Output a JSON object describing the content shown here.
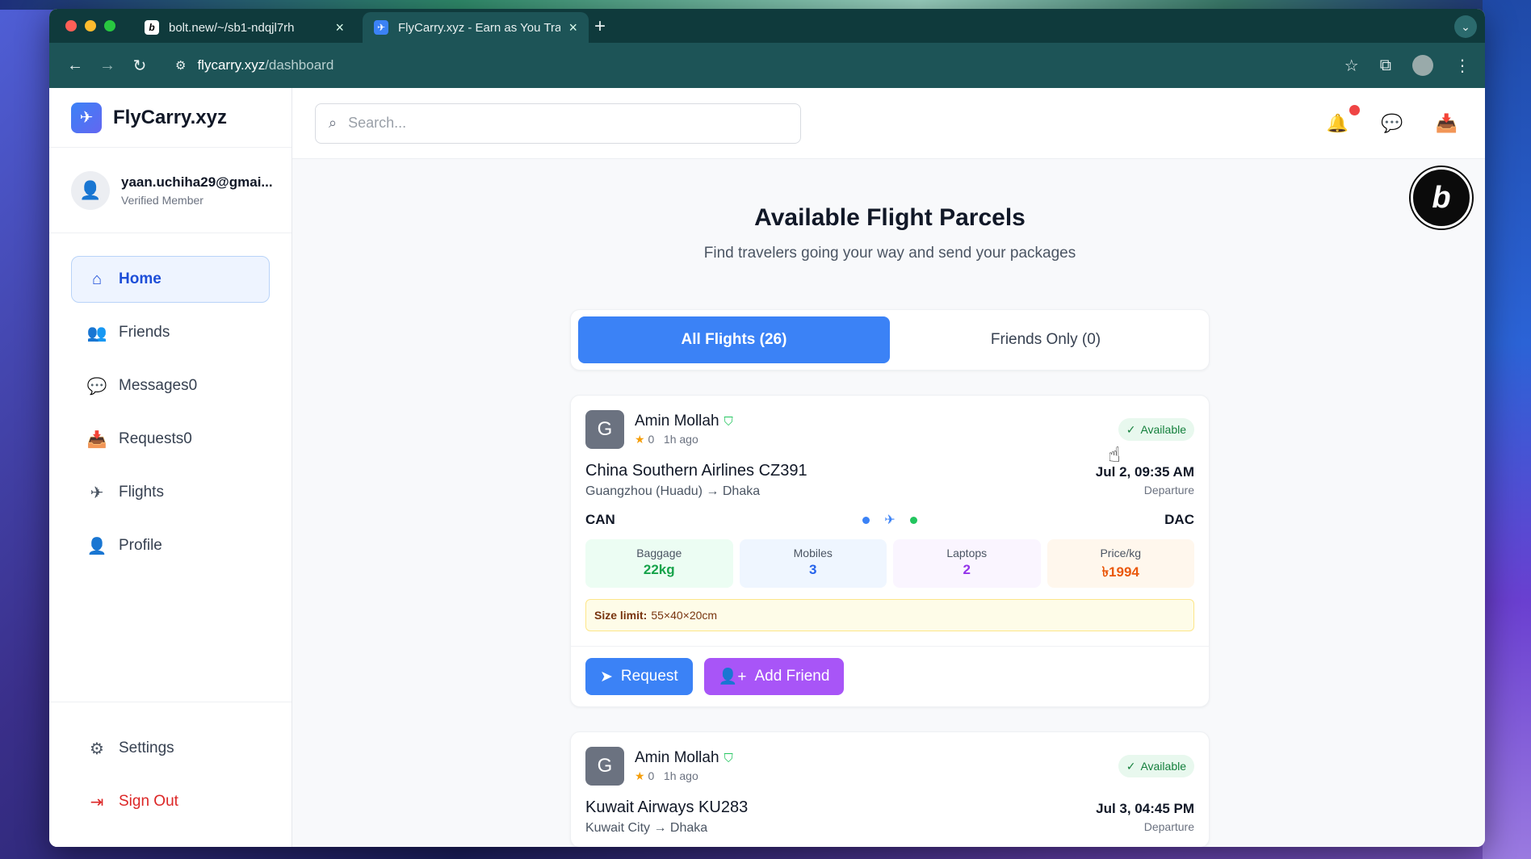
{
  "browser": {
    "tabs": [
      {
        "title": "bolt.new/~/sb1-ndqjl7rh",
        "favicon": "b"
      },
      {
        "title": "FlyCarry.xyz - Earn as You Tra",
        "favicon": "f"
      }
    ],
    "url_host": "flycarry.xyz",
    "url_path": "/dashboard"
  },
  "app": {
    "brand": "FlyCarry.xyz",
    "user": {
      "email": "yaan.uchiha29@gmai...",
      "status": "Verified Member"
    },
    "nav": [
      {
        "label": "Home",
        "icon": "home-icon",
        "active": true
      },
      {
        "label": "Friends",
        "icon": "users-icon"
      },
      {
        "label": "Messages0",
        "icon": "message-icon"
      },
      {
        "label": "Requests0",
        "icon": "inbox-icon"
      },
      {
        "label": "Flights",
        "icon": "plane-icon"
      },
      {
        "label": "Profile",
        "icon": "user-icon"
      }
    ],
    "bottom_nav": {
      "settings": "Settings",
      "signout": "Sign Out"
    },
    "search_placeholder": "Search...",
    "page_title": "Available Flight Parcels",
    "page_subtitle": "Find travelers going your way and send your packages",
    "filter_tabs": {
      "all": "All Flights (26)",
      "friends": "Friends Only (0)"
    },
    "colors": {
      "primary": "#3b82f6",
      "accent_purple": "#a855f7",
      "danger": "#dc2626"
    }
  },
  "cards": [
    {
      "avatar_letter": "G",
      "name": "Amin Mollah",
      "rating": "0",
      "time": "1h ago",
      "status": "Available",
      "airline": "China Southern Airlines CZ391",
      "route": "Guangzhou (Huadu) → Dhaka",
      "date": "Jul 2, 09:35 AM",
      "date_label": "Departure",
      "from_code": "CAN",
      "to_code": "DAC",
      "stats": {
        "baggage_label": "Baggage",
        "baggage": "22kg",
        "mobiles_label": "Mobiles",
        "mobiles": "3",
        "laptops_label": "Laptops",
        "laptops": "2",
        "price_label": "Price/kg",
        "price": "৳1994"
      },
      "size_label": "Size limit:",
      "size_value": "55×40×20cm",
      "request_label": "Request",
      "add_friend_label": "Add Friend"
    },
    {
      "avatar_letter": "G",
      "name": "Amin Mollah",
      "rating": "0",
      "time": "1h ago",
      "status": "Available",
      "airline": "Kuwait Airways KU283",
      "route": "Kuwait City → Dhaka",
      "date": "Jul 3, 04:45 PM",
      "date_label": "Departure"
    }
  ]
}
